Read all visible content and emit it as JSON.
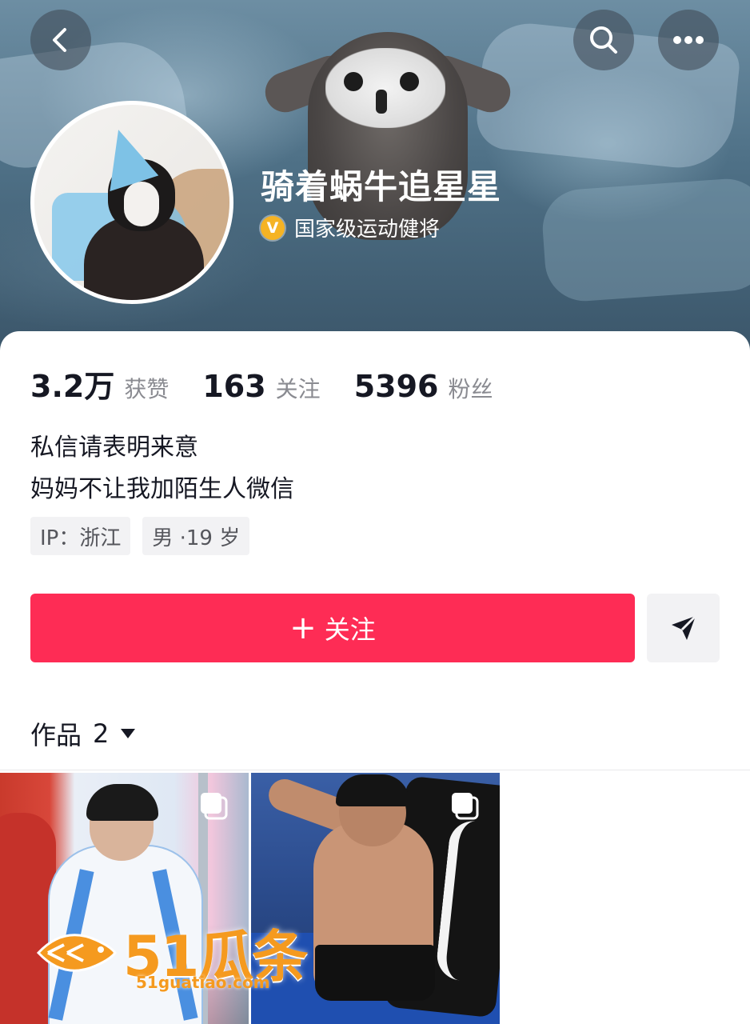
{
  "header": {
    "username": "骑着蜗牛追星星",
    "verified_badge_letter": "V",
    "verified_title": "国家级运动健将",
    "back_icon": "chevron-left-icon",
    "search_icon": "search-icon",
    "more_icon": "more-dots-icon"
  },
  "stats": [
    {
      "value": "3.2万",
      "label": "获赞"
    },
    {
      "value": "163",
      "label": "关注"
    },
    {
      "value": "5396",
      "label": "粉丝"
    }
  ],
  "bio": {
    "line1": "私信请表明来意",
    "line2": "妈妈不让我加陌生人微信"
  },
  "tags": [
    "IP：浙江",
    "男 ·19 岁"
  ],
  "actions": {
    "follow_plus": "+",
    "follow_label": "关注",
    "share_icon": "send-icon"
  },
  "works": {
    "label": "作品",
    "count": "2",
    "dropdown_icon": "caret-down-icon"
  },
  "videos": [
    {
      "name": "video-1",
      "multi_icon": "multi-image-icon"
    },
    {
      "name": "video-2",
      "multi_icon": "multi-image-icon"
    }
  ],
  "watermark": {
    "text": "51瓜条",
    "url": "51guatiao.com"
  },
  "colors": {
    "follow_button": "#fe2c55",
    "badge": "#f5b324",
    "watermark": "#f59a1f"
  }
}
